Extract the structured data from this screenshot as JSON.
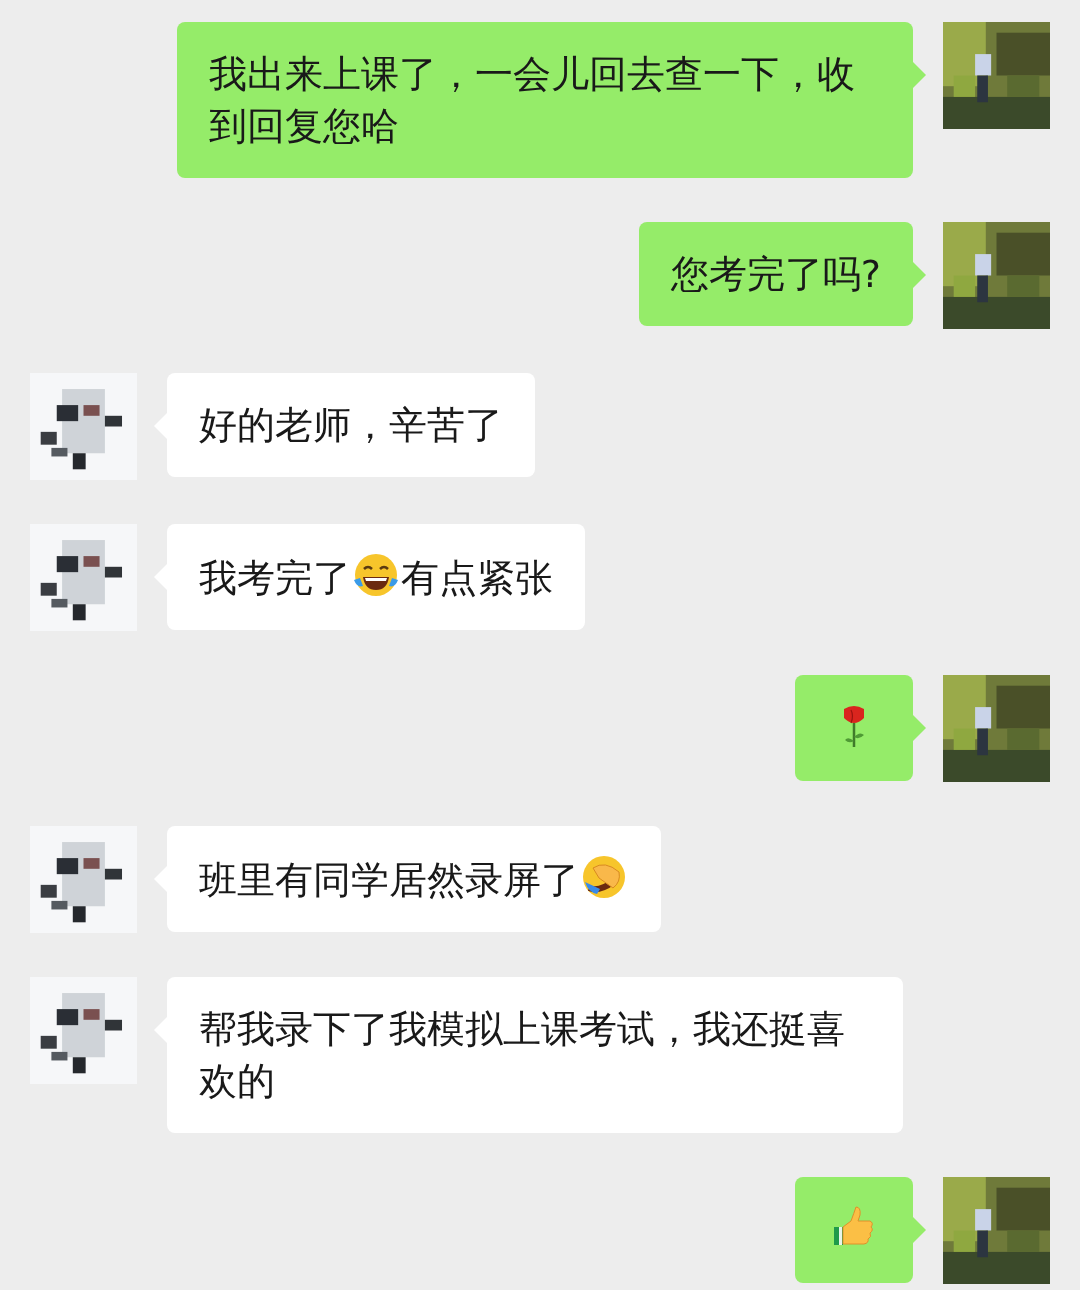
{
  "messages": [
    {
      "kind": "sent",
      "parts": [
        {
          "kind": "text",
          "text": "我出来上课了，一会儿回去查一下，收到回复您哈"
        }
      ]
    },
    {
      "kind": "sent",
      "parts": [
        {
          "kind": "text",
          "text": "您考完了吗?"
        }
      ]
    },
    {
      "kind": "received",
      "parts": [
        {
          "kind": "text",
          "text": "好的老师，辛苦了"
        }
      ]
    },
    {
      "kind": "received",
      "parts": [
        {
          "kind": "text",
          "text": "我考完了"
        },
        {
          "kind": "laughing-tears"
        },
        {
          "kind": "text",
          "text": "有点紧张"
        }
      ]
    },
    {
      "kind": "sent",
      "parts": [
        {
          "kind": "rose"
        }
      ]
    },
    {
      "kind": "received",
      "parts": [
        {
          "kind": "text",
          "text": "班里有同学居然录屏了"
        },
        {
          "kind": "facepalm"
        }
      ]
    },
    {
      "kind": "received",
      "parts": [
        {
          "kind": "text",
          "text": "帮我录下了我模拟上课考试，我还挺喜欢的"
        }
      ]
    },
    {
      "kind": "sent",
      "parts": [
        {
          "kind": "thumbs-up"
        }
      ]
    }
  ]
}
